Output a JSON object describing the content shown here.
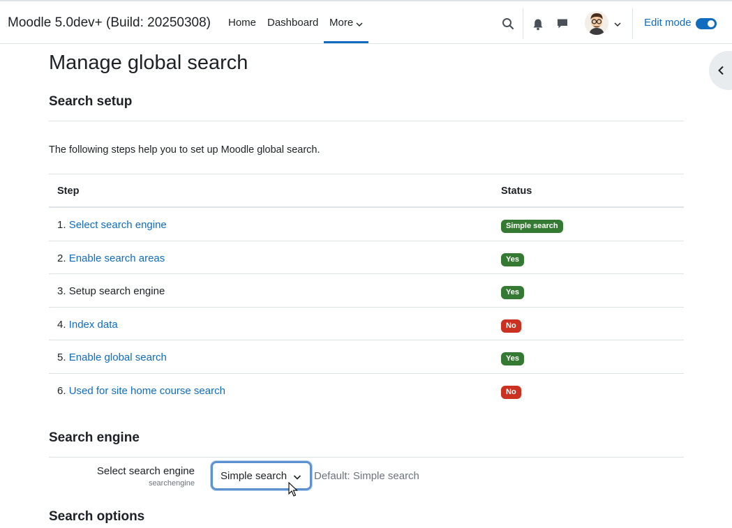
{
  "navbar": {
    "brand": "Moodle 5.0dev+ (Build: 20250308)",
    "links": [
      "Home",
      "Dashboard"
    ],
    "more_label": "More",
    "icons": [
      "search-icon",
      "bell-icon",
      "chat-icon",
      "avatar",
      "chevron-down-icon"
    ],
    "edit_mode_label": "Edit mode",
    "edit_mode_on": true
  },
  "page": {
    "title": "Manage global search",
    "setup_heading": "Search setup",
    "intro": "The following steps help you to set up Moodle global search.",
    "table": {
      "headers": [
        "Step",
        "Status"
      ],
      "rows": [
        {
          "num": "1.",
          "label": "Select search engine",
          "link": true,
          "status": "Simple search",
          "status_type": "success"
        },
        {
          "num": "2.",
          "label": "Enable search areas",
          "link": true,
          "status": "Yes",
          "status_type": "success"
        },
        {
          "num": "3.",
          "label": "Setup search engine",
          "link": false,
          "status": "Yes",
          "status_type": "success"
        },
        {
          "num": "4.",
          "label": "Index data",
          "link": true,
          "status": "No",
          "status_type": "danger"
        },
        {
          "num": "5.",
          "label": "Enable global search",
          "link": true,
          "status": "Yes",
          "status_type": "success"
        },
        {
          "num": "6.",
          "label": "Used for site home course search",
          "link": true,
          "status": "No",
          "status_type": "danger"
        }
      ]
    },
    "engine_heading": "Search engine",
    "setting": {
      "label": "Select search engine",
      "key": "searchengine",
      "selected": "Simple search",
      "default_text": "Default: Simple search"
    },
    "options_heading": "Search options"
  },
  "colors": {
    "link": "#0f6cbf",
    "success": "#357a32",
    "danger": "#ca3120"
  }
}
